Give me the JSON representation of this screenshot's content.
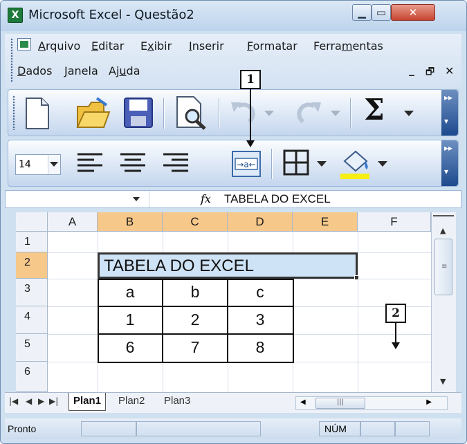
{
  "window": {
    "title": "Microsoft Excel - Questão2",
    "app_icon_glyph": "X"
  },
  "menu": {
    "items": [
      {
        "label": "Arquivo",
        "u": "A"
      },
      {
        "label": "Editar",
        "u": "E"
      },
      {
        "label": "Exibir",
        "u": "x"
      },
      {
        "label": "Inserir",
        "u": "I"
      },
      {
        "label": "Formatar",
        "u": "F"
      },
      {
        "label": "Ferramentas",
        "u": "m"
      },
      {
        "label": "Dados",
        "u": "D"
      },
      {
        "label": "Janela",
        "u": "J"
      },
      {
        "label": "Ajuda",
        "u": "u"
      }
    ]
  },
  "format_toolbar": {
    "font_size": "14"
  },
  "formula_bar": {
    "fx_label": "fx",
    "content": "TABELA DO EXCEL"
  },
  "columns": [
    "A",
    "B",
    "C",
    "D",
    "E",
    "F"
  ],
  "rows": [
    "1",
    "2",
    "3",
    "4",
    "5",
    "6"
  ],
  "cells": {
    "B2": "TABELA DO EXCEL",
    "B3": "a",
    "C3": "b",
    "D3": "c",
    "B4": "1",
    "C4": "2",
    "D4": "3",
    "B5": "6",
    "C5": "7",
    "D5": "8"
  },
  "sheets": [
    "Plan1",
    "Plan2",
    "Plan3"
  ],
  "status": {
    "left": "Pronto",
    "num": "NÚM"
  },
  "callouts": {
    "c1": "1",
    "c2": "2"
  },
  "colors": {
    "selected_header": "#f6c88a",
    "merged_fill": "#cfe3f6",
    "accent": "#1d4a8e"
  }
}
